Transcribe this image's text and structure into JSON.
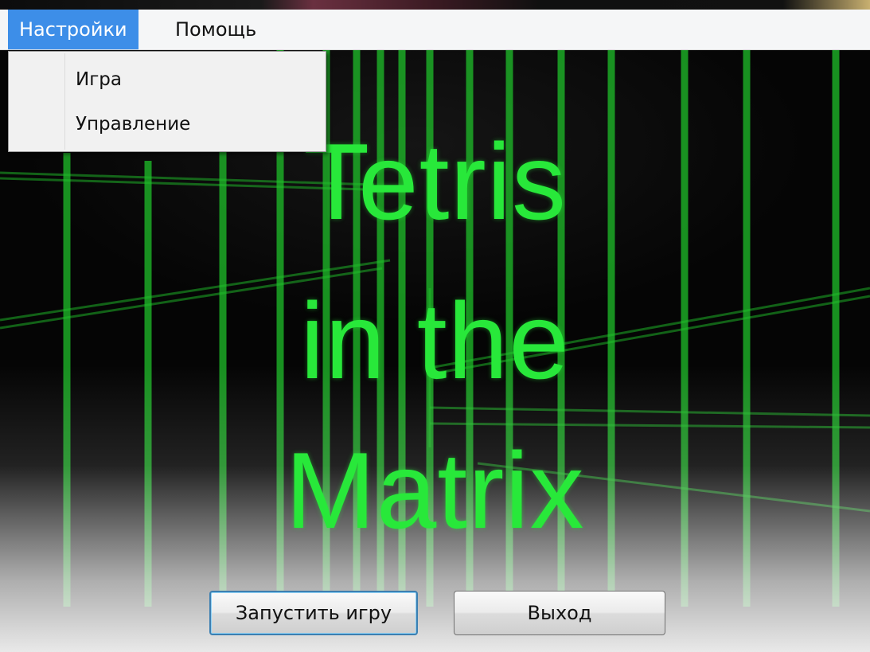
{
  "menubar": {
    "items": [
      {
        "label": "Настройки"
      },
      {
        "label": "Помощь"
      }
    ]
  },
  "dropdown": {
    "items": [
      {
        "label": "Игра"
      },
      {
        "label": "Управление"
      }
    ]
  },
  "title": {
    "line1": "Tetris",
    "line2": "in the",
    "line3": "Matrix"
  },
  "buttons": {
    "start_label": "Запустить игру",
    "exit_label": "Выход"
  },
  "colors": {
    "menu_highlight": "#3d8ee8",
    "title_green": "#28e83a",
    "matrix_line_green": "#1fbf2a",
    "default_button_border": "#3c7fb1"
  }
}
